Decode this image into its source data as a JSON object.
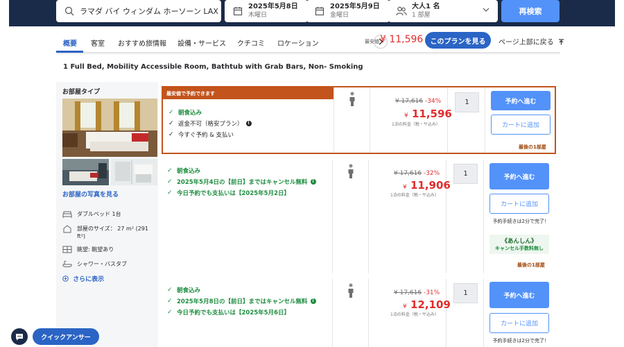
{
  "search": {
    "hotel": "ラマダ バイ ウィンダム ホーソーン LAX",
    "checkin_date": "2025年5月8日",
    "checkin_day": "木曜日",
    "checkout_date": "2025年5月9日",
    "checkout_day": "金曜日",
    "guests": "大人1 名",
    "rooms": "1 部屋",
    "search_button": "再検索"
  },
  "tabs": [
    "概要",
    "客室",
    "おすすめ旅情報",
    "設備・サービス",
    "クチコミ",
    "ロケーション"
  ],
  "nav": {
    "lowest_label": "最安値",
    "lowest_price": "¥ 11,596",
    "plans_button": "このプランを見る",
    "page_top": "ページ上部に戻る"
  },
  "room": {
    "title": "1 Full Bed, Mobility Accessible Room, Bathtub with Grab Bars, Non- Smoking",
    "type_label": "お部屋タイプ",
    "photos_link": "お部屋の写真を見る",
    "features": [
      {
        "icon": "bed-icon",
        "text": "ダブルベッド 1台"
      },
      {
        "icon": "room-size-icon",
        "text": "部屋のサイズ： 27 m² (291 ft²)"
      },
      {
        "icon": "view-icon",
        "text": "眺望: 眺望あり"
      },
      {
        "icon": "shower-icon",
        "text": "シャワー・バスタブ"
      }
    ],
    "more_link": "さらに表示"
  },
  "offers": [
    {
      "banner": "最安値で予約できます",
      "benefits": [
        {
          "text": "朝食込み",
          "style": "green"
        },
        {
          "text": "返金不可（格安プラン）",
          "style": "black",
          "info": true
        },
        {
          "text": "今すぐ予約 & 支払い",
          "style": "black"
        }
      ],
      "original": "¥ 17,616",
      "discount": "-34%",
      "currency": "¥",
      "price": "11,596",
      "per_night": "1泊の料金（税・サ込み）",
      "qty": "1",
      "book": "予約へ進む",
      "cart": "カートに追加",
      "last": "最後の1部屋"
    },
    {
      "benefits": [
        {
          "text": "朝食込み",
          "style": "green"
        },
        {
          "text": "2025年5月4日の【前日】まではキャンセル無料",
          "style": "green",
          "info": true
        },
        {
          "text": "今日予約でも支払いは【2025年5月2日】",
          "style": "green"
        }
      ],
      "original": "¥ 17,616",
      "discount": "-32%",
      "currency": "¥",
      "price": "11,906",
      "per_night": "1泊の料金（税・サ込み）",
      "qty": "1",
      "book": "予約へ進む",
      "cart": "カートに追加",
      "quick_note": "予約手続きは2分で完了！",
      "anshin_title": "《あんしん》",
      "anshin_sub": "キャンセル手数料無し",
      "last": "最後の1部屋"
    },
    {
      "benefits": [
        {
          "text": "朝食込み",
          "style": "green"
        },
        {
          "text": "2025年5月8日の【前日】まではキャンセル無料",
          "style": "green",
          "info": true
        },
        {
          "text": "今日予約でも支払いは【2025年5月6日】",
          "style": "green"
        }
      ],
      "original": "¥ 17,616",
      "discount": "-31%",
      "currency": "¥",
      "price": "12,109",
      "per_night": "1泊の料金（税・サ込み）",
      "qty": "1",
      "book": "予約へ進む",
      "cart": "カートに追加",
      "quick_note": "予約手続きは2分で完了！"
    }
  ],
  "footer": {
    "quick_answer": "クイックアンサー"
  },
  "colors": {
    "navy": "#1a2b49",
    "primary_blue": "#5392f9",
    "link_blue": "#2a64c5",
    "price_red": "#e12d2d",
    "best_orange": "#c2541c",
    "green": "#1c8d3e"
  }
}
